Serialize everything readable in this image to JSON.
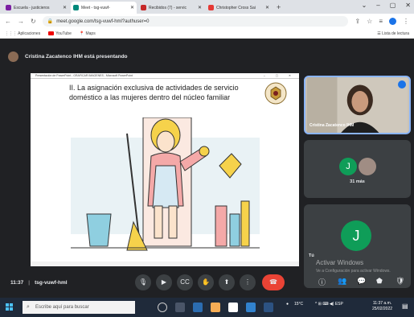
{
  "tabs": [
    {
      "label": "Escuela - justicieros",
      "color": "#7b1fa2",
      "active": false
    },
    {
      "label": "Meet - tsg-vuwf-",
      "color": "#00897b",
      "active": true
    },
    {
      "label": "Recibidos (7) - servic",
      "color": "#c62828",
      "active": false
    },
    {
      "label": "Christopher Cross Sai",
      "color": "#e53935",
      "active": false
    }
  ],
  "newtab": "+",
  "window_controls": [
    "⌄",
    "–",
    "▢",
    "✕"
  ],
  "address": {
    "url": "meet.google.com/tsg-vuwf-hml?authuser=0"
  },
  "bookmarks": {
    "apps": "Aplicaciones",
    "youtube": "YouTube",
    "maps": "Maps",
    "reading_list": "Lista de lectura"
  },
  "meet": {
    "presenting": "Cristina Zacatenco IHM está presentando",
    "slide_window_title": "Presentación de PowerPoint - GRAFICAR IMAGENES - Microsoft PowerPoint",
    "slide_title": "II. La asignación exclusiva de actividades de servicio doméstico a las mujeres dentro del núcleo familiar",
    "tile1_name": "Cristina Zacatenco IHM",
    "tile2_label": "J",
    "tile2_name": "31 más",
    "tile3_label": "J",
    "tile3_name": "Tú",
    "watermark_title": "Activar Windows",
    "watermark_sub": "Ve a Configuración para activar Windows.",
    "time": "11:37",
    "meeting_code": "tsg-vuwf-hml"
  },
  "taskbar": {
    "search_placeholder": "Escribe aquí para buscar",
    "temp": "15°C",
    "time": "11:37 a.m.",
    "date": "25/02/2022"
  },
  "colors": {
    "meet_bg": "#202124",
    "end_call": "#ea4335",
    "avatar_green": "#0f9d58",
    "accent": "#1a73e8"
  }
}
